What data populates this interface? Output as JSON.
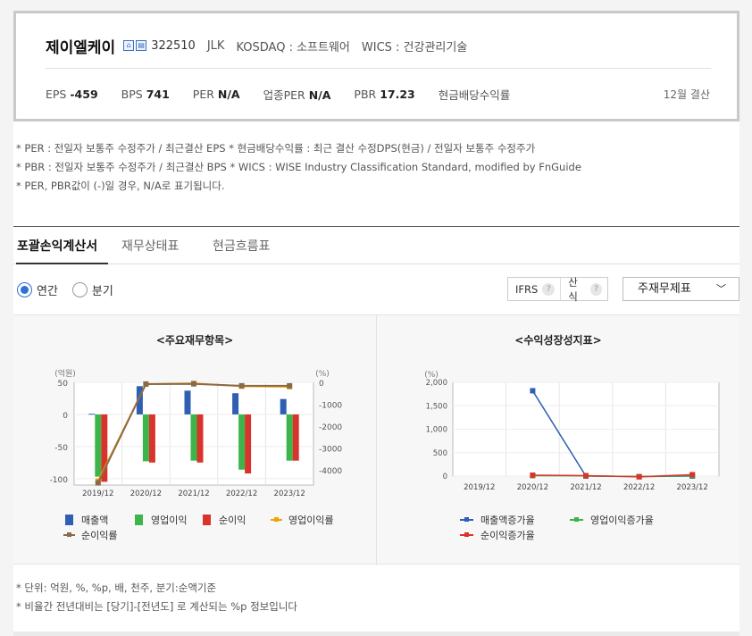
{
  "header": {
    "company_name": "제이엘케이",
    "icons": [
      "home-icon",
      "report-icon"
    ],
    "code": "322510",
    "ticker": "JLK",
    "market": "KOSDAQ : 소프트웨어",
    "wics": "WICS : 건강관리기술",
    "eps_label": "EPS",
    "eps_value": "-459",
    "bps_label": "BPS",
    "bps_value": "741",
    "per_label": "PER",
    "per_value": "N/A",
    "ind_per_label": "업종PER",
    "ind_per_value": "N/A",
    "pbr_label": "PBR",
    "pbr_value": "17.23",
    "div_label": "현금배당수익률",
    "settlement": "12월 결산"
  },
  "notes": [
    "* PER : 전일자 보통주 수정주가 / 최근결산 EPS * 현금배당수익률 : 최근 결산 수정DPS(현금) / 전일자 보통주 수정주가",
    "* PBR : 전일자 보통주 수정주가 / 최근결산 BPS * WICS : WISE Industry Classification Standard, modified by FnGuide",
    "* PER, PBR값이 (-)일 경우, N/A로 표기됩니다."
  ],
  "tabs": [
    {
      "label": "포괄손익계산서"
    },
    {
      "label": "재무상태표"
    },
    {
      "label": "현금흐름표"
    }
  ],
  "period": {
    "annual": "연간",
    "quarter": "분기"
  },
  "options": {
    "ifrs": "IFRS",
    "ifrs_q": "?",
    "calc": "산식",
    "calc_q": "?",
    "select_value": "주재무제표"
  },
  "colors": {
    "sales": "#2f5fb3",
    "op": "#3cb54a",
    "net": "#d9342b",
    "op_rate": "#f0a500",
    "net_rate": "#8b6a4a"
  },
  "chart_data": [
    {
      "type": "bar",
      "title": "<주요재무항목>",
      "categories": [
        "2019/12",
        "2020/12",
        "2021/12",
        "2022/12",
        "2023/12"
      ],
      "y_left_unit": "(억원)",
      "y_right_unit": "(%)",
      "ylim_left": [
        -110,
        50
      ],
      "ylim_right": [
        -4700,
        0
      ],
      "yticks_left": [
        "50",
        "0",
        "-50",
        "-100"
      ],
      "yticks_right": [
        "0",
        "-1000",
        "-2000",
        "-3000",
        "-4000"
      ],
      "series": [
        {
          "name": "매출액",
          "values": [
            1,
            44,
            37,
            33,
            24
          ]
        },
        {
          "name": "영업이익",
          "values": [
            -97,
            -73,
            -72,
            -86,
            -72
          ]
        },
        {
          "name": "순이익",
          "values": [
            -105,
            -75,
            -75,
            -92,
            -72
          ]
        }
      ],
      "rate_series": [
        {
          "name": "영업이익률",
          "values": [
            -4520,
            -80,
            -50,
            -180,
            -200
          ]
        },
        {
          "name": "순이익률",
          "values": [
            -4600,
            -80,
            -70,
            -160,
            -160
          ]
        }
      ]
    },
    {
      "type": "line",
      "title": "<수익성장성지표>",
      "categories": [
        "2019/12",
        "2020/12",
        "2021/12",
        "2022/12",
        "2023/12"
      ],
      "y_unit": "(%)",
      "ylim": [
        0,
        2000
      ],
      "yticks": [
        "2,000",
        "1,500",
        "1,000",
        "500",
        "0"
      ],
      "series": [
        {
          "name": "매출액증가율",
          "values": [
            null,
            1820,
            0,
            -10,
            0
          ]
        },
        {
          "name": "영업이익증가율",
          "values": [
            null,
            10,
            5,
            -10,
            10
          ]
        },
        {
          "name": "순이익증가율",
          "values": [
            null,
            20,
            10,
            -15,
            30
          ]
        }
      ]
    }
  ],
  "units_notes": [
    "* 단위: 억원, %, %p, 배, 천주, 분기:순액기준",
    "* 비율간 전년대비는 [당기]-[전년도] 로 계산되는 %p 정보입니다"
  ]
}
